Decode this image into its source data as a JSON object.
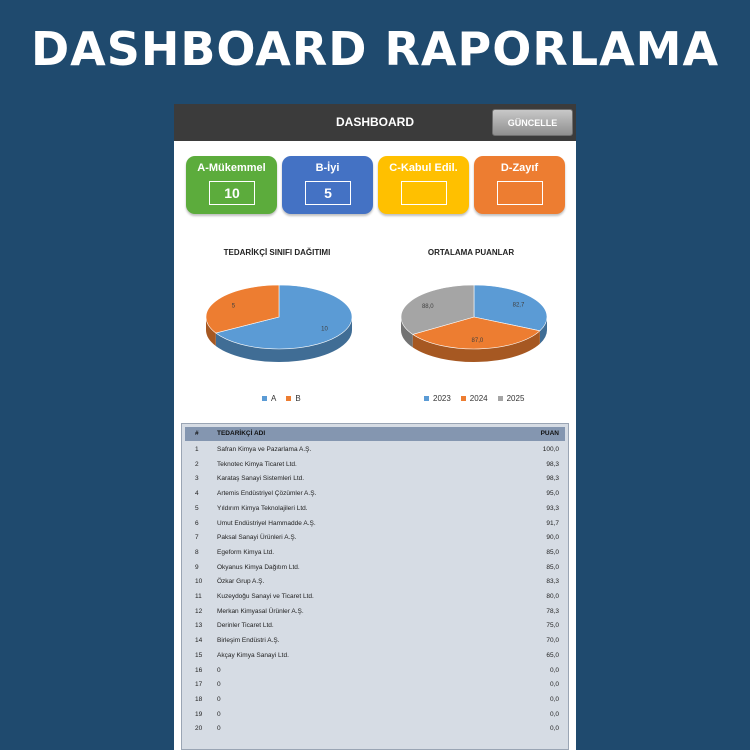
{
  "page_title": "DASHBOARD RAPORLAMA",
  "topbar": {
    "title": "DASHBOARD",
    "update_label": "GÜNCELLE"
  },
  "cards": [
    {
      "label": "A-Mükemmel",
      "value": "10",
      "color": "#5cac3c"
    },
    {
      "label": "B-İyi",
      "value": "5",
      "color": "#4472c4"
    },
    {
      "label": "C-Kabul Edil.",
      "value": "",
      "color": "#ffc000"
    },
    {
      "label": "D-Zayıf",
      "value": "",
      "color": "#ed7d31"
    }
  ],
  "charts": {
    "distribution": {
      "title": "TEDARİKÇİ SINIFI DAĞITIMI",
      "legend": [
        "A",
        "B"
      ]
    },
    "averages": {
      "title": "ORTALAMA PUANLAR",
      "legend": [
        "2023",
        "2024",
        "2025"
      ]
    }
  },
  "chart_data": [
    {
      "type": "pie",
      "title": "TEDARİKÇİ SINIFI DAĞITIMI",
      "categories": [
        "A",
        "B"
      ],
      "values": [
        10,
        5
      ],
      "data_labels": [
        "10",
        "5"
      ],
      "colors": [
        "#5b9bd5",
        "#ed7d31"
      ],
      "legend": "bottom"
    },
    {
      "type": "pie",
      "title": "ORTALAMA PUANLAR",
      "categories": [
        "2023",
        "2024",
        "2025"
      ],
      "values": [
        82.7,
        87.0,
        88.0
      ],
      "data_labels": [
        "82,7",
        "87,0",
        "88,0"
      ],
      "colors": [
        "#5b9bd5",
        "#ed7d31",
        "#a5a5a5"
      ],
      "legend": "bottom"
    }
  ],
  "table": {
    "headers": {
      "no": "#",
      "name": "TEDARİKÇİ ADI",
      "score": "PUAN"
    },
    "rows": [
      {
        "no": "1",
        "name": "Safran Kimya ve Pazarlama A.Ş.",
        "score": "100,0"
      },
      {
        "no": "2",
        "name": "Teknotec Kimya Ticaret Ltd.",
        "score": "98,3"
      },
      {
        "no": "3",
        "name": "Karataş Sanayi Sistemleri Ltd.",
        "score": "98,3"
      },
      {
        "no": "4",
        "name": "Artemis Endüstriyel Çözümler A.Ş.",
        "score": "95,0"
      },
      {
        "no": "5",
        "name": "Yıldırım Kimya Teknolajileri Ltd.",
        "score": "93,3"
      },
      {
        "no": "6",
        "name": "Umut Endüstriyel Hammadde A.Ş.",
        "score": "91,7"
      },
      {
        "no": "7",
        "name": "Paksal Sanayi Ürünleri A.Ş.",
        "score": "90,0"
      },
      {
        "no": "8",
        "name": "Egeform Kimya Ltd.",
        "score": "85,0"
      },
      {
        "no": "9",
        "name": "Okyanus Kimya Dağıtım Ltd.",
        "score": "85,0"
      },
      {
        "no": "10",
        "name": "Özkar Grup A.Ş.",
        "score": "83,3"
      },
      {
        "no": "11",
        "name": "Kuzeydoğu Sanayi ve Ticaret Ltd.",
        "score": "80,0"
      },
      {
        "no": "12",
        "name": "Merkan Kimyasal Ürünler A.Ş.",
        "score": "78,3"
      },
      {
        "no": "13",
        "name": "Derinler Ticaret Ltd.",
        "score": "75,0"
      },
      {
        "no": "14",
        "name": "Birleşim Endüstri A.Ş.",
        "score": "70,0"
      },
      {
        "no": "15",
        "name": "Akçay Kimya Sanayi Ltd.",
        "score": "65,0"
      },
      {
        "no": "16",
        "name": "0",
        "score": "0,0"
      },
      {
        "no": "17",
        "name": "0",
        "score": "0,0"
      },
      {
        "no": "18",
        "name": "0",
        "score": "0,0"
      },
      {
        "no": "19",
        "name": "0",
        "score": "0,0"
      },
      {
        "no": "20",
        "name": "0",
        "score": "0,0"
      }
    ]
  }
}
